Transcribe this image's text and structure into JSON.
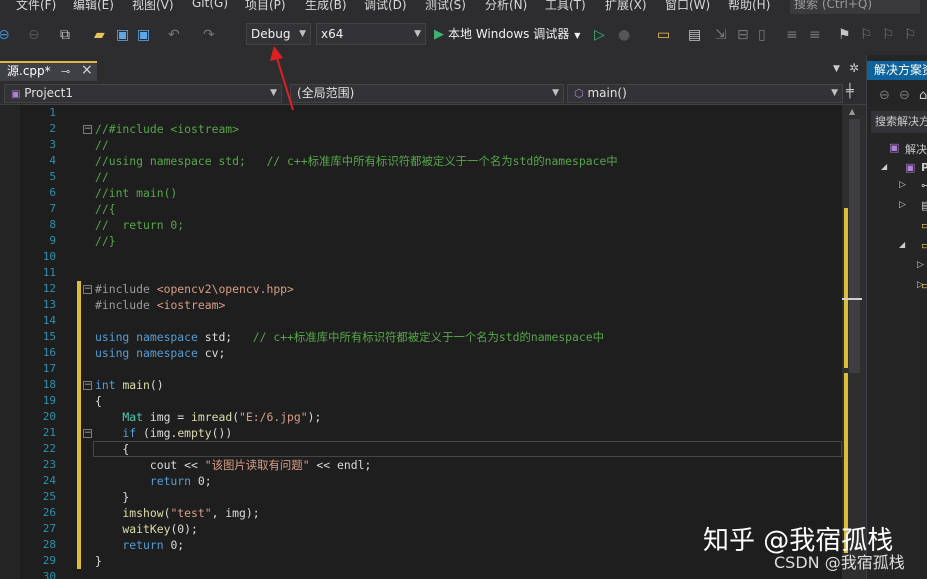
{
  "menu": {
    "items": [
      "文件(F)",
      "编辑(E)",
      "视图(V)",
      "Git(G)",
      "项目(P)",
      "生成(B)",
      "调试(D)",
      "测试(S)",
      "分析(N)",
      "工具(T)",
      "扩展(X)",
      "窗口(W)",
      "帮助(H)"
    ],
    "search_placeholder": "搜索 (Ctrl+Q)"
  },
  "toolbar": {
    "config": "Debug",
    "platform": "x64",
    "run_label": "本地 Windows 调试器"
  },
  "tab": {
    "title": "源.cpp*",
    "pin": "⊸",
    "close": "×"
  },
  "nav": {
    "project": "Project1",
    "scope": "(全局范围)",
    "member": "main()"
  },
  "code_lines": [
    {
      "n": "1",
      "segs": []
    },
    {
      "n": "2",
      "segs": [
        {
          "c": "c",
          "t": "//#include <iostream>"
        }
      ]
    },
    {
      "n": "3",
      "segs": [
        {
          "c": "c",
          "t": "//"
        }
      ]
    },
    {
      "n": "4",
      "segs": [
        {
          "c": "c",
          "t": "//using namespace std;   // c++标准库中所有标识符都被定义于一个名为std的namespace中"
        }
      ]
    },
    {
      "n": "5",
      "segs": [
        {
          "c": "c",
          "t": "//"
        }
      ]
    },
    {
      "n": "6",
      "segs": [
        {
          "c": "c",
          "t": "//int main()"
        }
      ]
    },
    {
      "n": "7",
      "segs": [
        {
          "c": "c",
          "t": "//{"
        }
      ]
    },
    {
      "n": "8",
      "segs": [
        {
          "c": "c",
          "t": "//  return 0;"
        }
      ]
    },
    {
      "n": "9",
      "segs": [
        {
          "c": "c",
          "t": "//}"
        }
      ]
    },
    {
      "n": "10",
      "segs": []
    },
    {
      "n": "11",
      "segs": []
    },
    {
      "n": "12",
      "segs": [
        {
          "c": "p",
          "t": "#include "
        },
        {
          "c": "s",
          "t": "<opencv2\\opencv.hpp>"
        }
      ]
    },
    {
      "n": "13",
      "segs": [
        {
          "c": "p",
          "t": "#include "
        },
        {
          "c": "s",
          "t": "<iostream>"
        }
      ]
    },
    {
      "n": "14",
      "segs": []
    },
    {
      "n": "15",
      "segs": [
        {
          "c": "k",
          "t": "using namespace "
        },
        {
          "c": "d",
          "t": "std;   "
        },
        {
          "c": "c",
          "t": "// c++标准库中所有标识符都被定义于一个名为std的namespace中"
        }
      ]
    },
    {
      "n": "16",
      "segs": [
        {
          "c": "k",
          "t": "using namespace "
        },
        {
          "c": "d",
          "t": "cv;"
        }
      ]
    },
    {
      "n": "17",
      "segs": []
    },
    {
      "n": "18",
      "segs": [
        {
          "c": "k",
          "t": "int "
        },
        {
          "c": "f",
          "t": "main"
        },
        {
          "c": "d",
          "t": "()"
        }
      ]
    },
    {
      "n": "19",
      "segs": [
        {
          "c": "d",
          "t": "{"
        }
      ]
    },
    {
      "n": "20",
      "segs": [
        {
          "c": "t",
          "t": "    Mat "
        },
        {
          "c": "d",
          "t": "img = "
        },
        {
          "c": "f",
          "t": "imread"
        },
        {
          "c": "d",
          "t": "("
        },
        {
          "c": "s",
          "t": "\"E:/6.jpg\""
        },
        {
          "c": "d",
          "t": ");"
        }
      ]
    },
    {
      "n": "21",
      "segs": [
        {
          "c": "k",
          "t": "    if "
        },
        {
          "c": "d",
          "t": "(img."
        },
        {
          "c": "f",
          "t": "empty"
        },
        {
          "c": "d",
          "t": "())"
        }
      ]
    },
    {
      "n": "22",
      "segs": [
        {
          "c": "d",
          "t": "    {"
        }
      ]
    },
    {
      "n": "23",
      "segs": [
        {
          "c": "d",
          "t": "        cout << "
        },
        {
          "c": "s",
          "t": "\"该图片读取有问题\""
        },
        {
          "c": "d",
          "t": " << endl;"
        }
      ]
    },
    {
      "n": "24",
      "segs": [
        {
          "c": "k",
          "t": "        return "
        },
        {
          "c": "d",
          "t": "0;"
        }
      ]
    },
    {
      "n": "25",
      "segs": [
        {
          "c": "d",
          "t": "    }"
        }
      ]
    },
    {
      "n": "26",
      "segs": [
        {
          "c": "f",
          "t": "    imshow"
        },
        {
          "c": "d",
          "t": "("
        },
        {
          "c": "s",
          "t": "\"test\""
        },
        {
          "c": "d",
          "t": ", img);"
        }
      ]
    },
    {
      "n": "27",
      "segs": [
        {
          "c": "f",
          "t": "    waitKey"
        },
        {
          "c": "d",
          "t": "(0);"
        }
      ]
    },
    {
      "n": "28",
      "segs": [
        {
          "c": "k",
          "t": "    return "
        },
        {
          "c": "d",
          "t": "0;"
        }
      ]
    },
    {
      "n": "29",
      "segs": [
        {
          "c": "d",
          "t": "}"
        }
      ]
    },
    {
      "n": "30",
      "segs": []
    }
  ],
  "solution": {
    "title": "解决方案资",
    "search": "搜索解决方",
    "item1": "解决",
    "item2": "P"
  },
  "watermark": {
    "main": "知乎 @我宿孤栈",
    "sub": "CSDN @我宿孤栈"
  }
}
